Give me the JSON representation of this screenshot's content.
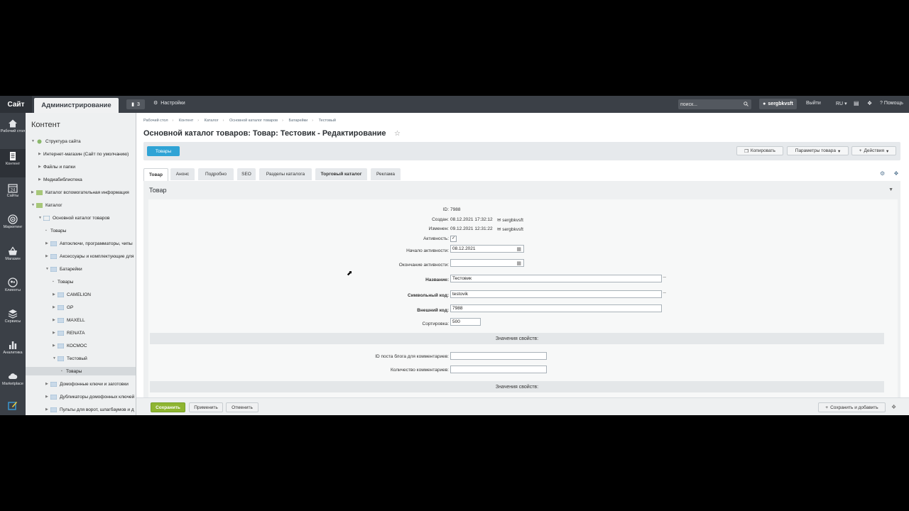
{
  "topbar": {
    "site": "Сайт",
    "admin": "Администрирование",
    "notifications": "3",
    "settings": "Настройки",
    "search_placeholder": "поиск...",
    "user": "sergbkvsft",
    "logout": "Выйти",
    "lang": "RU",
    "help": "Помощь"
  },
  "iconbar": {
    "items": [
      {
        "label": "Рабочий стол",
        "icon": "home-icon"
      },
      {
        "label": "Контент",
        "icon": "document-icon"
      },
      {
        "label": "Сайты",
        "icon": "calendar-icon",
        "badge": "24"
      },
      {
        "label": "Маркетинг",
        "icon": "target-icon"
      },
      {
        "label": "Магазин",
        "icon": "basket-icon"
      },
      {
        "label": "Клиенты",
        "icon": "clients-icon"
      },
      {
        "label": "Сервисы",
        "icon": "layers-icon"
      },
      {
        "label": "Аналитика",
        "icon": "chart-icon"
      },
      {
        "label": "Marketplace",
        "icon": "cloud-icon"
      }
    ]
  },
  "tree": {
    "title": "Контент",
    "items": [
      {
        "label": "Структура сайта"
      },
      {
        "label": "Интернет-магазин (Сайт по умолчанию)"
      },
      {
        "label": "Файлы и папки"
      },
      {
        "label": "Медиабиблиотека"
      },
      {
        "label": "Каталог вспомогательная информация"
      },
      {
        "label": "Каталог"
      },
      {
        "label": "Основной каталог товаров"
      },
      {
        "label": "Товары"
      },
      {
        "label": "Автоключи, программаторы, чипы"
      },
      {
        "label": "Аксессуары и комплектующие для"
      },
      {
        "label": "Батарейки"
      },
      {
        "label": "Товары"
      },
      {
        "label": "CAMELION"
      },
      {
        "label": "GP"
      },
      {
        "label": "MAXELL"
      },
      {
        "label": "RENATA"
      },
      {
        "label": "КОСМОС"
      },
      {
        "label": "Тестовый"
      },
      {
        "label": "Товары"
      },
      {
        "label": "Домофонные ключи и заготовки"
      },
      {
        "label": "Дубликаторы домофонных ключей"
      },
      {
        "label": "Пульты для ворот, шлагбаумов и д"
      }
    ]
  },
  "breadcrumbs": [
    "Рабочий стол",
    "Контент",
    "Каталог",
    "Основной каталог товаров",
    "Батарейки",
    "Тестовый"
  ],
  "page": {
    "title": "Основной каталог товаров: Товар: Тестовик - Редактирование"
  },
  "context": {
    "back_button": "Товары",
    "copy": "Копировать",
    "params": "Параметры товара",
    "actions": "Действия"
  },
  "tabs": [
    "Товар",
    "Анонс",
    "Подробно",
    "SEO",
    "Разделы каталога",
    "Торговый каталог",
    "Реклама"
  ],
  "section": {
    "title": "Товар"
  },
  "form": {
    "id_label": "ID:",
    "id_value": "7988",
    "created_label": "Создан:",
    "created_value": "08.12.2021 17:32:12",
    "created_user": "sergbkvsft",
    "changed_label": "Изменен:",
    "changed_value": "09.12.2021 12:31:22",
    "changed_user": "sergbkvsft",
    "active_label": "Активность:",
    "active_checked": true,
    "start_label": "Начало активности:",
    "start_value": "08.12.2021",
    "end_label": "Окончание активности:",
    "end_value": "",
    "name_label": "Название:",
    "name_value": "Тестовик",
    "code_label": "Символьный код:",
    "code_value": "testovik",
    "ext_label": "Внешний код:",
    "ext_value": "7988",
    "sort_label": "Сортировка:",
    "sort_value": "500",
    "props_header": "Значения свойств:",
    "blog_label": "ID поста блога для комментариев:",
    "comments_label": "Количество комментариев:",
    "props_header2": "Значения свойств:"
  },
  "footer": {
    "save": "Сохранить",
    "apply": "Применить",
    "cancel": "Отменить",
    "save_add": "Сохранить и добавить"
  }
}
